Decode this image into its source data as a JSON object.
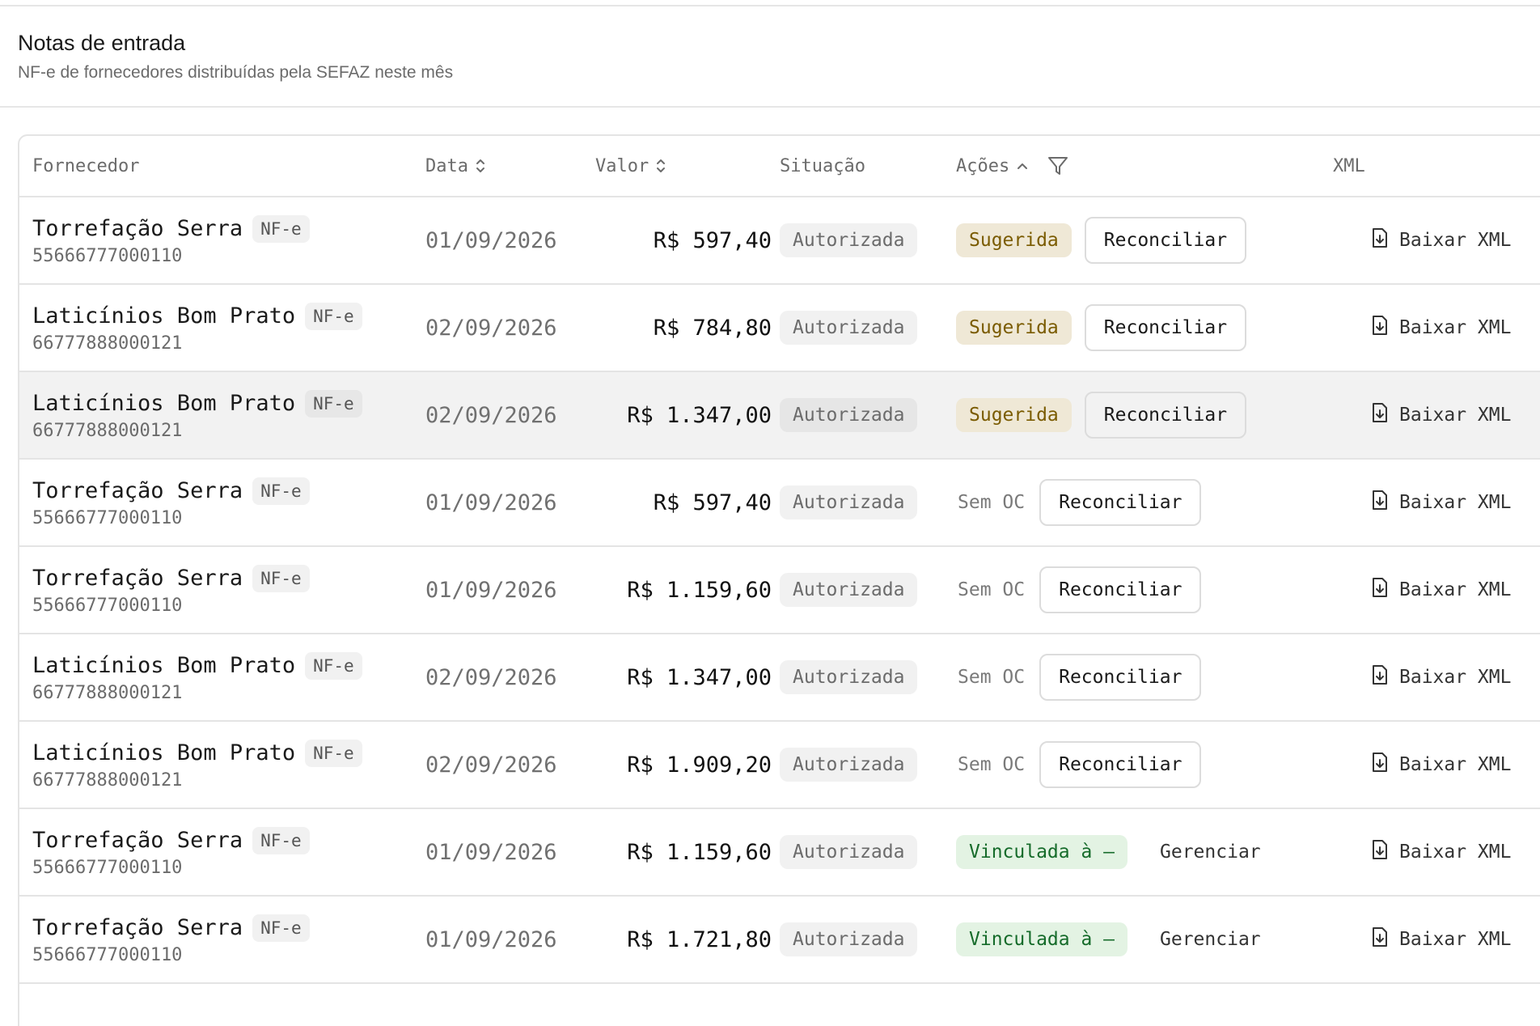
{
  "header": {
    "title": "Notas de entrada",
    "subtitle": "NF-e de fornecedores distribuídas pela SEFAZ neste mês"
  },
  "table": {
    "columns": {
      "supplier": "Fornecedor",
      "date": "Data",
      "value": "Valor",
      "status": "Situação",
      "actions": "Ações",
      "xml": "XML"
    },
    "labels": {
      "reconcile": "Reconciliar",
      "manage": "Gerenciar",
      "download_xml": "Baixar XML",
      "suggested": "Sugerida",
      "no_po": "Sem OC",
      "linked": "Vinculada à —"
    },
    "rows": [
      {
        "supplier": "Torrefação Serra",
        "doc_type": "NF-e",
        "cnpj": "55666777000110",
        "date": "01/09/2026",
        "value": "R$ 597,40",
        "status": "Autorizada",
        "action_state": "suggested"
      },
      {
        "supplier": "Laticínios Bom Prato",
        "doc_type": "NF-e",
        "cnpj": "66777888000121",
        "date": "02/09/2026",
        "value": "R$ 784,80",
        "status": "Autorizada",
        "action_state": "suggested"
      },
      {
        "supplier": "Laticínios Bom Prato",
        "doc_type": "NF-e",
        "cnpj": "66777888000121",
        "date": "02/09/2026",
        "value": "R$ 1.347,00",
        "status": "Autorizada",
        "action_state": "suggested",
        "highlighted": true
      },
      {
        "supplier": "Torrefação Serra",
        "doc_type": "NF-e",
        "cnpj": "55666777000110",
        "date": "01/09/2026",
        "value": "R$ 597,40",
        "status": "Autorizada",
        "action_state": "no_po"
      },
      {
        "supplier": "Torrefação Serra",
        "doc_type": "NF-e",
        "cnpj": "55666777000110",
        "date": "01/09/2026",
        "value": "R$ 1.159,60",
        "status": "Autorizada",
        "action_state": "no_po"
      },
      {
        "supplier": "Laticínios Bom Prato",
        "doc_type": "NF-e",
        "cnpj": "66777888000121",
        "date": "02/09/2026",
        "value": "R$ 1.347,00",
        "status": "Autorizada",
        "action_state": "no_po"
      },
      {
        "supplier": "Laticínios Bom Prato",
        "doc_type": "NF-e",
        "cnpj": "66777888000121",
        "date": "02/09/2026",
        "value": "R$ 1.909,20",
        "status": "Autorizada",
        "action_state": "no_po"
      },
      {
        "supplier": "Torrefação Serra",
        "doc_type": "NF-e",
        "cnpj": "55666777000110",
        "date": "01/09/2026",
        "value": "R$ 1.159,60",
        "status": "Autorizada",
        "action_state": "linked"
      },
      {
        "supplier": "Torrefação Serra",
        "doc_type": "NF-e",
        "cnpj": "55666777000110",
        "date": "01/09/2026",
        "value": "R$ 1.721,80",
        "status": "Autorizada",
        "action_state": "linked"
      }
    ]
  }
}
